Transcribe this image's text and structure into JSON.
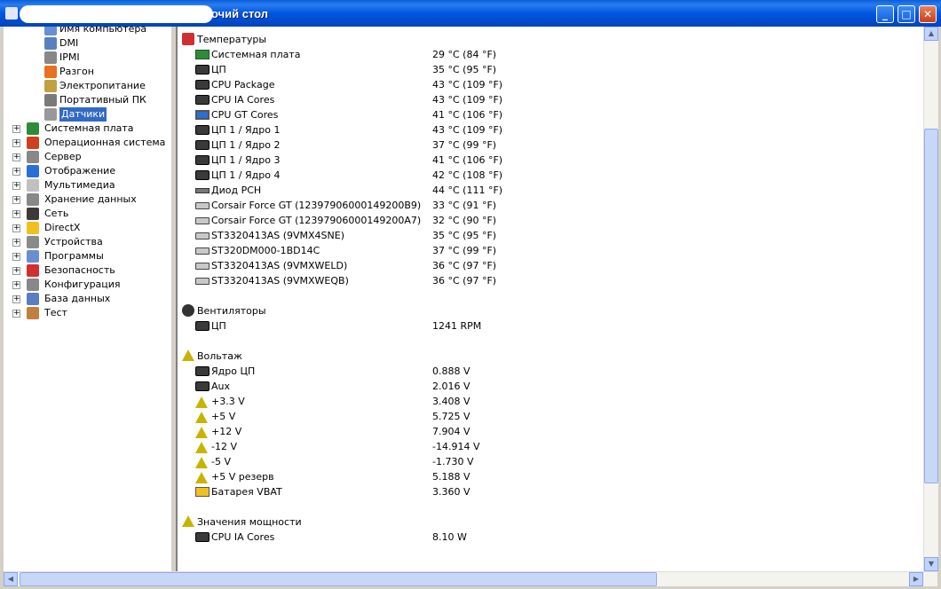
{
  "window": {
    "title": "очий стол"
  },
  "tree": {
    "items": [
      {
        "label": "Имя компьютера",
        "icon": "computer-name-icon",
        "selected": false
      },
      {
        "label": "DMI",
        "icon": "dmi-icon",
        "selected": false
      },
      {
        "label": "IPMI",
        "icon": "ipmi-icon",
        "selected": false
      },
      {
        "label": "Разгон",
        "icon": "flame-icon",
        "selected": false
      },
      {
        "label": "Электропитание",
        "icon": "power-icon",
        "selected": false
      },
      {
        "label": "Портативный ПК",
        "icon": "laptop-icon",
        "selected": false
      },
      {
        "label": "Датчики",
        "icon": "sensor-icon",
        "selected": true
      },
      {
        "label": "Системная плата",
        "icon": "motherboard-icon",
        "expander": "+"
      },
      {
        "label": "Операционная система",
        "icon": "windows-icon",
        "expander": "+"
      },
      {
        "label": "Сервер",
        "icon": "server-icon",
        "expander": "+"
      },
      {
        "label": "Отображение",
        "icon": "monitor-icon",
        "expander": "+"
      },
      {
        "label": "Мультимедиа",
        "icon": "speaker-icon",
        "expander": "+"
      },
      {
        "label": "Хранение данных",
        "icon": "storage-icon",
        "expander": "+"
      },
      {
        "label": "Сеть",
        "icon": "network-icon",
        "expander": "+"
      },
      {
        "label": "DirectX",
        "icon": "directx-icon",
        "expander": "+"
      },
      {
        "label": "Устройства",
        "icon": "devices-icon",
        "expander": "+"
      },
      {
        "label": "Программы",
        "icon": "programs-icon",
        "expander": "+"
      },
      {
        "label": "Безопасность",
        "icon": "shield-icon",
        "expander": "+"
      },
      {
        "label": "Конфигурация",
        "icon": "config-icon",
        "expander": "+"
      },
      {
        "label": "База данных",
        "icon": "database-icon",
        "expander": "+"
      },
      {
        "label": "Тест",
        "icon": "hourglass-icon",
        "expander": "+"
      }
    ]
  },
  "sections": {
    "temps": {
      "title": "Температуры",
      "items": [
        {
          "name": "Системная плата",
          "value": "29 °C  (84 °F)",
          "icon": "board"
        },
        {
          "name": "ЦП",
          "value": "35 °C  (95 °F)",
          "icon": "chip"
        },
        {
          "name": "CPU Package",
          "value": "43 °C  (109 °F)",
          "icon": "chip"
        },
        {
          "name": "CPU IA Cores",
          "value": "43 °C  (109 °F)",
          "icon": "chip"
        },
        {
          "name": "CPU GT Cores",
          "value": "41 °C  (106 °F)",
          "icon": "monitor"
        },
        {
          "name": "ЦП 1 / Ядро 1",
          "value": "43 °C  (109 °F)",
          "icon": "chip"
        },
        {
          "name": "ЦП 1 / Ядро 2",
          "value": "37 °C  (99 °F)",
          "icon": "chip"
        },
        {
          "name": "ЦП 1 / Ядро 3",
          "value": "41 °C  (106 °F)",
          "icon": "chip"
        },
        {
          "name": "ЦП 1 / Ядро 4",
          "value": "42 °C  (108 °F)",
          "icon": "chip"
        },
        {
          "name": "Диод PCH",
          "value": "44 °C  (111 °F)",
          "icon": "ram"
        },
        {
          "name": "Corsair Force GT (12397906000149200B9)",
          "value": "33 °C  (91 °F)",
          "icon": "disk"
        },
        {
          "name": "Corsair Force GT (12397906000149200A7)",
          "value": "32 °C  (90 °F)",
          "icon": "disk"
        },
        {
          "name": "ST3320413AS (9VMX4SNE)",
          "value": "35 °C  (95 °F)",
          "icon": "disk"
        },
        {
          "name": "ST320DM000-1BD14C",
          "value": "37 °C  (99 °F)",
          "icon": "disk"
        },
        {
          "name": "ST3320413AS (9VMXWELD)",
          "value": "36 °C  (97 °F)",
          "icon": "disk"
        },
        {
          "name": "ST3320413AS (9VMXWEQB)",
          "value": "36 °C  (97 °F)",
          "icon": "disk"
        }
      ]
    },
    "fans": {
      "title": "Вентиляторы",
      "items": [
        {
          "name": "ЦП",
          "value": "1241 RPM",
          "icon": "chip"
        }
      ]
    },
    "voltage": {
      "title": "Вольтаж",
      "items": [
        {
          "name": "Ядро ЦП",
          "value": "0.888 V",
          "icon": "chip"
        },
        {
          "name": "Aux",
          "value": "2.016 V",
          "icon": "chip"
        },
        {
          "name": "+3.3 V",
          "value": "3.408 V",
          "icon": "tri"
        },
        {
          "name": "+5 V",
          "value": "5.725 V",
          "icon": "tri"
        },
        {
          "name": "+12 V",
          "value": "7.904 V",
          "icon": "tri"
        },
        {
          "name": "-12 V",
          "value": "-14.914 V",
          "icon": "tri"
        },
        {
          "name": "-5 V",
          "value": "-1.730 V",
          "icon": "tri"
        },
        {
          "name": "+5 V резерв",
          "value": "5.188 V",
          "icon": "tri"
        },
        {
          "name": "Батарея VBAT",
          "value": "3.360 V",
          "icon": "battery"
        }
      ]
    },
    "power": {
      "title": "Значения мощности",
      "items": [
        {
          "name": "CPU IA Cores",
          "value": "8.10 W",
          "icon": "chip"
        }
      ]
    }
  }
}
